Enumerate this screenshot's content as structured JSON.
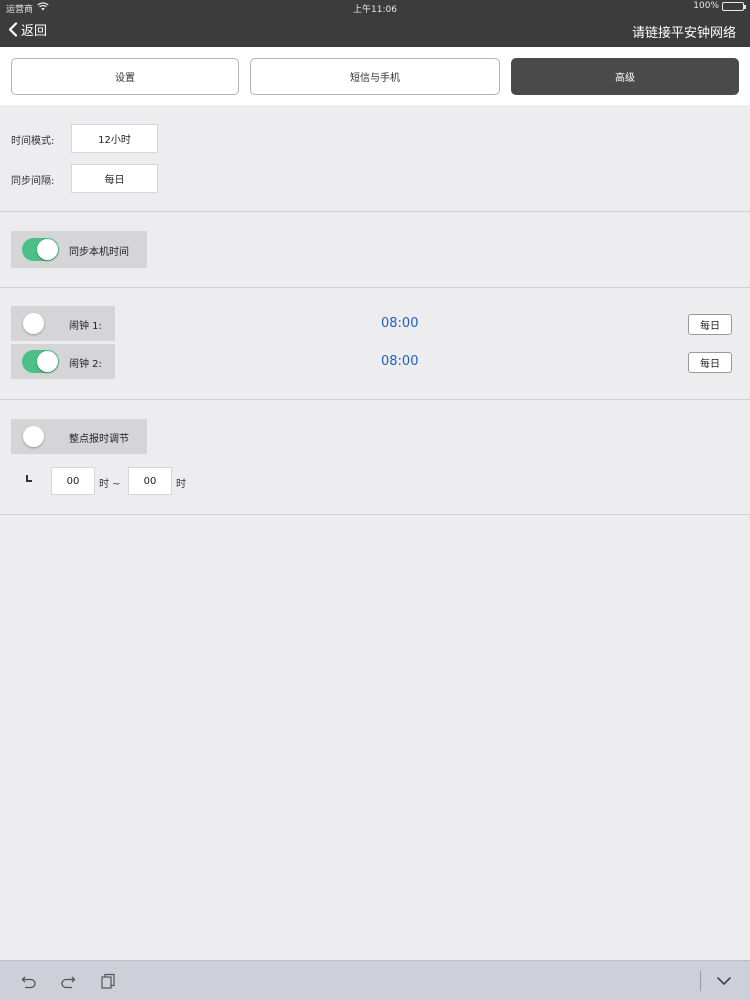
{
  "status_bar": {
    "carrier": "运营商",
    "time": "上午11:06",
    "battery": "100%"
  },
  "nav": {
    "back_label": "返回",
    "title": "请链接平安钟网络"
  },
  "tabs": [
    {
      "label": "设置",
      "active": false
    },
    {
      "label": "短信与手机",
      "active": false
    },
    {
      "label": "高级",
      "active": true
    }
  ],
  "time_settings": {
    "mode_label": "时间模式:",
    "mode_value": "12小时",
    "sync_interval_label": "同步间隔:",
    "sync_interval_value": "每日"
  },
  "sync_local": {
    "label": "同步本机时间",
    "enabled": true
  },
  "alarms": [
    {
      "label": "闹钟 1:",
      "enabled": false,
      "time": "08:00",
      "repeat": "每日"
    },
    {
      "label": "闹钟 2:",
      "enabled": true,
      "time": "08:00",
      "repeat": "每日"
    }
  ],
  "hourly_chime": {
    "label": "整点报时调节",
    "enabled": false,
    "start": "00",
    "start_unit": "时 ~",
    "end": "00",
    "end_unit": "时"
  },
  "colors": {
    "toggle_on": "#4dbf87",
    "alarm_time": "#1f5fbf",
    "active_tab": "#4a4a4a",
    "nav_bg": "#3c3c3c"
  },
  "bottom_toolbar": {
    "icons": [
      "undo-icon",
      "redo-icon",
      "paste-icon",
      "chevron-down-icon"
    ]
  }
}
